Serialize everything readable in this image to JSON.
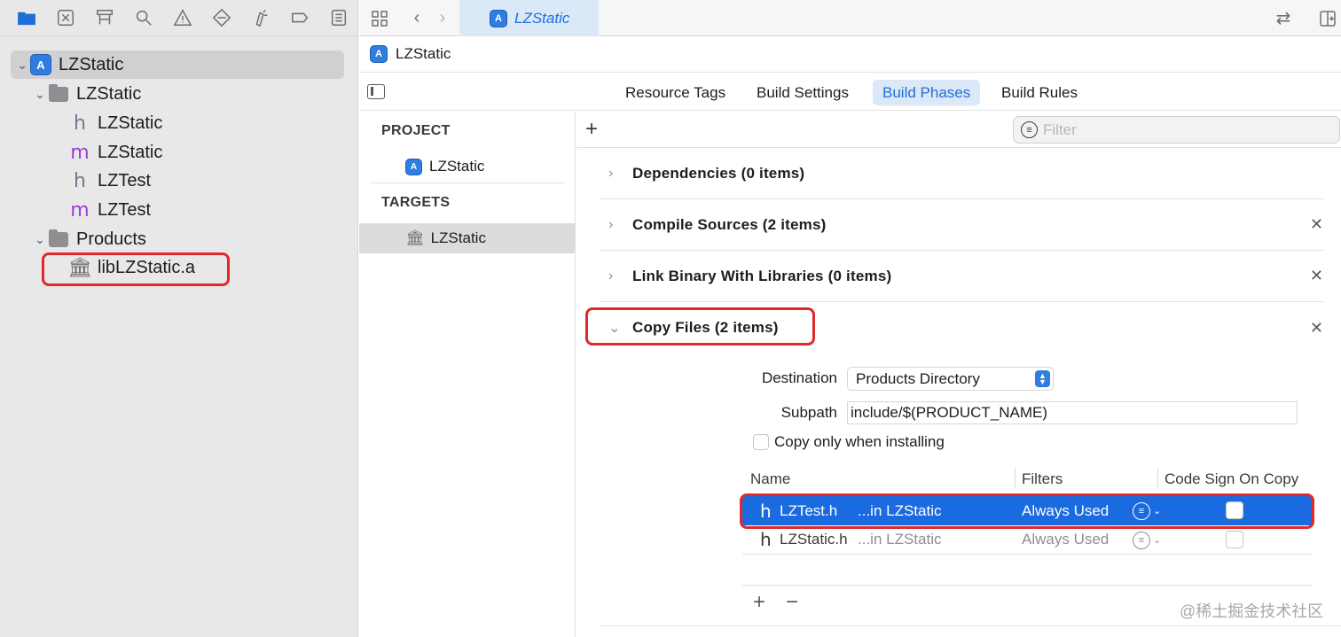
{
  "navigator_toolbar": {
    "icons": [
      "folder-icon",
      "source-control-icon",
      "hierarchy-icon",
      "search-icon",
      "warning-icon",
      "test-icon",
      "debug-icon",
      "breakpoint-icon",
      "report-icon"
    ]
  },
  "tree": {
    "project": "LZStatic",
    "group": "LZStatic",
    "files": [
      {
        "type": "h",
        "name": "LZStatic"
      },
      {
        "type": "m",
        "name": "LZStatic"
      },
      {
        "type": "h",
        "name": "LZTest"
      },
      {
        "type": "m",
        "name": "LZTest"
      }
    ],
    "products_group": "Products",
    "product": "libLZStatic.a"
  },
  "editor": {
    "tab_title": "LZStatic",
    "jump_bar": "LZStatic",
    "tabs": [
      "Resource Tags",
      "Build Settings",
      "Build Phases",
      "Build Rules"
    ],
    "active_tab": "Build Phases"
  },
  "targets_pane": {
    "project_header": "PROJECT",
    "project_item": "LZStatic",
    "targets_header": "TARGETS",
    "target_item": "LZStatic"
  },
  "phases": {
    "add_symbol": "+",
    "filter_placeholder": "Filter",
    "items": [
      {
        "title": "Dependencies (0 items)",
        "closable": false
      },
      {
        "title": "Compile Sources (2 items)",
        "closable": true
      },
      {
        "title": "Link Binary With Libraries (0 items)",
        "closable": true
      },
      {
        "title": "Copy Files (2 items)",
        "closable": true
      }
    ],
    "copy_files": {
      "destination_label": "Destination",
      "destination_value": "Products Directory",
      "subpath_label": "Subpath",
      "subpath_value": "include/$(PRODUCT_NAME)",
      "copy_only_label": "Copy only when installing",
      "columns": [
        "Name",
        "Filters",
        "Code Sign On Copy"
      ],
      "rows": [
        {
          "icon": "h",
          "name": "LZTest.h",
          "location": "...in LZStatic",
          "filter": "Always Used",
          "selected": true
        },
        {
          "icon": "h",
          "name": "LZStatic.h",
          "location": "...in LZStatic",
          "filter": "Always Used",
          "selected": false
        }
      ],
      "add_symbol": "+",
      "remove_symbol": "−"
    }
  },
  "watermark": "@稀土掘金技术社区",
  "colors": {
    "accent": "#1e6fd9",
    "selection": "#1a6be0",
    "highlight_box": "#e0292d"
  }
}
